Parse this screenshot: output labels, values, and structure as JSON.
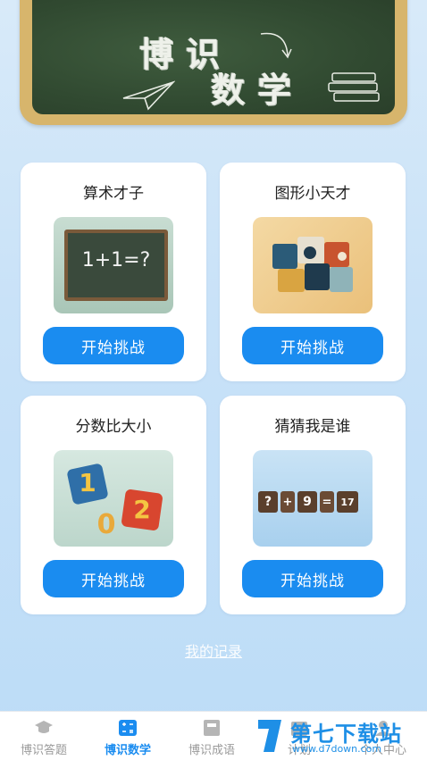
{
  "banner": {
    "title_line1": "博识",
    "title_line2": "数学"
  },
  "cards": [
    {
      "title": "算术才子",
      "button": "开始挑战",
      "image_text": "1+1=?"
    },
    {
      "title": "图形小天才",
      "button": "开始挑战"
    },
    {
      "title": "分数比大小",
      "button": "开始挑战",
      "image_digits": [
        "1",
        "0",
        "2"
      ]
    },
    {
      "title": "猜猜我是谁",
      "button": "开始挑战",
      "image_tiles": [
        "?",
        "+",
        "9",
        "=",
        "17"
      ]
    }
  ],
  "record_link": "我的记录",
  "tabs": [
    {
      "label": "博识答题",
      "icon": "graduation-cap-icon"
    },
    {
      "label": "博识数学",
      "icon": "calculator-icon",
      "active": true
    },
    {
      "label": "博识成语",
      "icon": "book-icon"
    },
    {
      "label": "计划",
      "icon": "calendar-icon"
    },
    {
      "label": "个人中心",
      "icon": "user-icon"
    }
  ],
  "watermark": {
    "brand": "第七下载站",
    "url": "www.d7down.com"
  },
  "colors": {
    "accent": "#1a8cf0",
    "board": "#314a31",
    "frame": "#d7b56c"
  }
}
